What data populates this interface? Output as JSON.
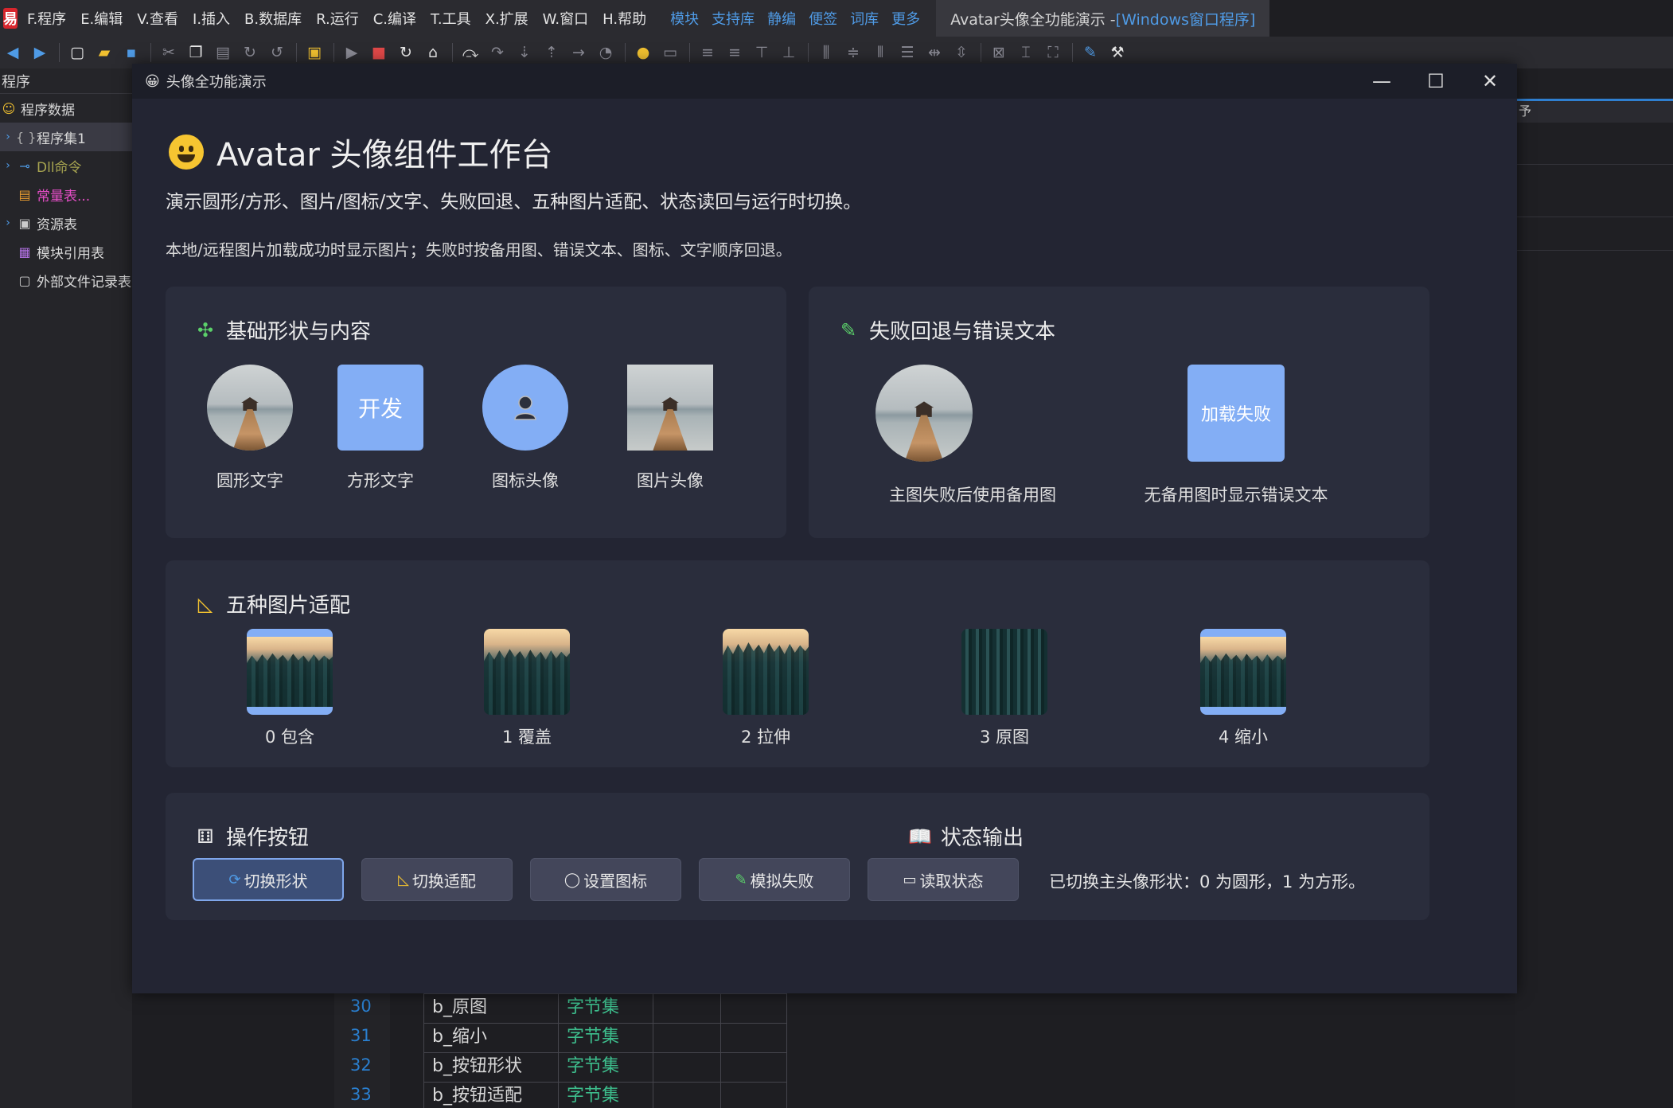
{
  "menubar": {
    "logo": "易",
    "items": [
      "F.程序",
      "E.编辑",
      "V.查看",
      "I.插入",
      "B.数据库",
      "R.运行",
      "C.编译",
      "T.工具",
      "X.扩展",
      "W.窗口",
      "H.帮助"
    ],
    "links": [
      "模块",
      "支持库",
      "静编",
      "便签",
      "词库",
      "更多"
    ],
    "title_prefix": "Avatar头像全功能演示 - ",
    "title_accent": "[Windows窗口程序]"
  },
  "sidebar": {
    "header": "程序",
    "items": [
      {
        "label": "程序数据",
        "icon": "☺"
      },
      {
        "label": "程序集1",
        "icon": "{ }"
      },
      {
        "label": "Dll命令",
        "icon": "⊸"
      },
      {
        "label": "常量表...",
        "icon": "▤"
      },
      {
        "label": "资源表",
        "icon": "▣"
      },
      {
        "label": "模块引用表",
        "icon": "▦"
      },
      {
        "label": "外部文件记录表",
        "icon": "▢"
      }
    ]
  },
  "right_pane": {
    "tab": "予"
  },
  "code_rows": [
    {
      "num": "30",
      "name": "b_原图",
      "type": "字节集"
    },
    {
      "num": "31",
      "name": "b_缩小",
      "type": "字节集"
    },
    {
      "num": "32",
      "name": "b_按钮形状",
      "type": "字节集"
    },
    {
      "num": "33",
      "name": "b_按钮适配",
      "type": "字节集"
    }
  ],
  "window": {
    "title": "头像全功能演示",
    "heading": "Avatar 头像组件工作台",
    "desc1": "演示圆形/方形、图片/图标/文字、失败回退、五种图片适配、状态读回与运行时切换。",
    "desc2": "本地/远程图片加载成功时显示图片；失败时按备用图、错误文本、图标、文字顺序回退。"
  },
  "basic_card": {
    "title": "基础形状与内容",
    "title_icon": "puzzle-icon",
    "items": [
      {
        "label": "圆形文字"
      },
      {
        "label": "方形文字",
        "text": "开发"
      },
      {
        "label": "图标头像"
      },
      {
        "label": "图片头像"
      }
    ]
  },
  "fallback_card": {
    "title": "失败回退与错误文本",
    "title_icon": "test-tube-icon",
    "items": [
      {
        "label": "主图失败后使用备用图"
      },
      {
        "label": "无备用图时显示错误文本",
        "text": "加载失败"
      }
    ]
  },
  "fit_card": {
    "title": "五种图片适配",
    "title_icon": "triangle-ruler-icon",
    "items": [
      {
        "label": "0 包含",
        "mode": "contain"
      },
      {
        "label": "1 覆盖",
        "mode": "cover"
      },
      {
        "label": "2 拉伸",
        "mode": "stretch"
      },
      {
        "label": "3 原图",
        "mode": "original"
      },
      {
        "label": "4 缩小",
        "mode": "scale-down"
      }
    ]
  },
  "actions_card": {
    "title": "操作按钮",
    "title_icon": "dice-icon",
    "buttons": [
      {
        "label": "切换形状",
        "icon": "⟳"
      },
      {
        "label": "切换适配",
        "icon": "◺"
      },
      {
        "label": "设置图标",
        "icon": "◯"
      },
      {
        "label": "模拟失败",
        "icon": "✎"
      },
      {
        "label": "读取状态",
        "icon": "▭"
      }
    ]
  },
  "status_card": {
    "title": "状态输出",
    "title_icon": "book-icon",
    "text": "已切换主头像形状：0 为圆形，1 为方形。"
  },
  "colors": {
    "accent": "#83aef5",
    "window_bg": "#232533",
    "card_bg": "#2a2d3c",
    "ide_link": "#4f9be6"
  }
}
